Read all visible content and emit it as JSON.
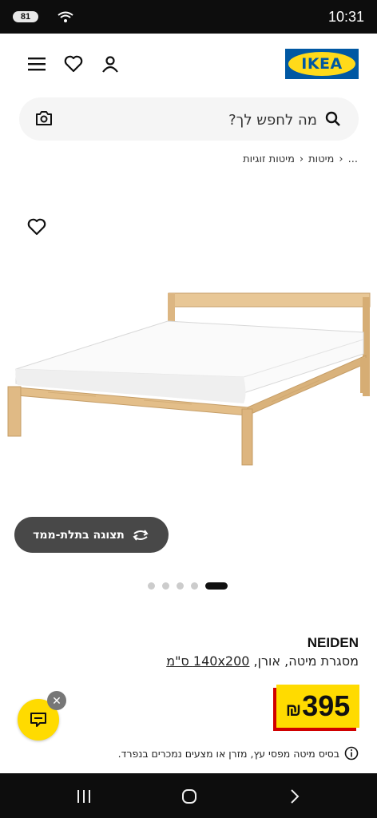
{
  "status_bar": {
    "time": "10:31",
    "battery": "81"
  },
  "header": {
    "logo_text": "IKEA",
    "menu_icon": "menu-icon",
    "wishlist_icon": "heart-icon",
    "account_icon": "person-icon"
  },
  "search": {
    "placeholder": "מה לחפש לך?",
    "search_icon": "search-icon",
    "camera_icon": "camera-icon"
  },
  "breadcrumb": {
    "items": [
      "...",
      "מיטות",
      "מיטות זוגיות"
    ]
  },
  "gallery": {
    "button_3d_label": "תצוגה בתלת-ממד",
    "dots_count": 5,
    "active_dot": 0
  },
  "product": {
    "name": "NEIDEN",
    "description_prefix": "מסגרת מיטה, אורן,",
    "description_size": "140x200 ס\"מ",
    "price": "395",
    "currency": "₪",
    "note": "בסיס מיטה מפסי עץ, מזרן או מצעים נמכרים בנפרד."
  },
  "colors": {
    "ikea_blue": "#0058a3",
    "ikea_yellow": "#ffda1a",
    "price_red": "#d00000"
  }
}
